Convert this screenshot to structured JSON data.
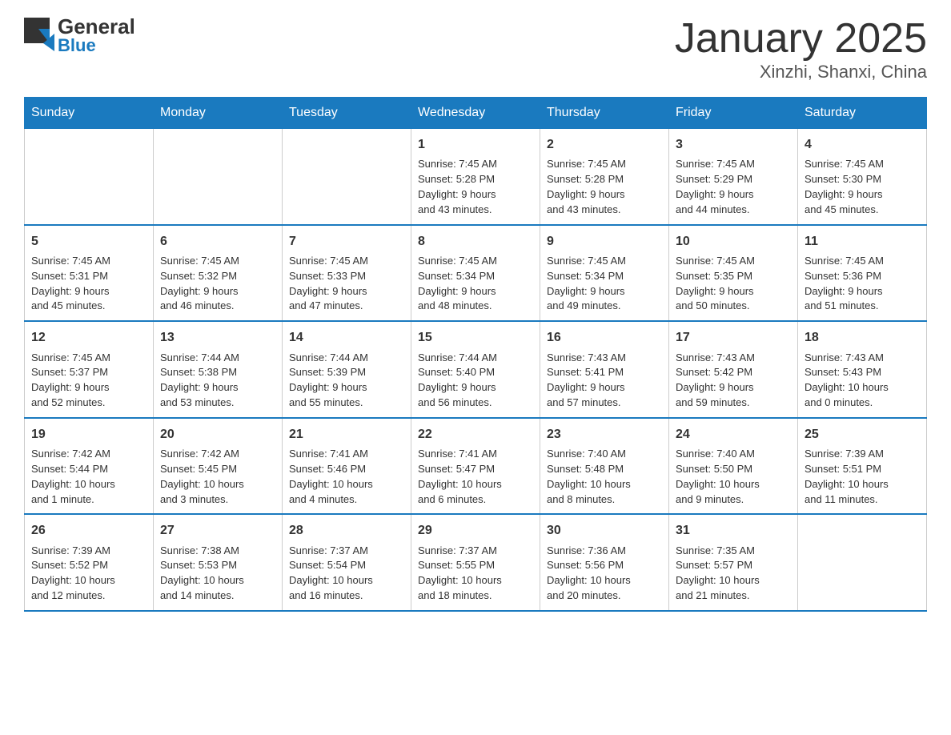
{
  "header": {
    "title": "January 2025",
    "subtitle": "Xinzhi, Shanxi, China",
    "logo": {
      "general": "General",
      "blue": "Blue"
    }
  },
  "weekdays": [
    "Sunday",
    "Monday",
    "Tuesday",
    "Wednesday",
    "Thursday",
    "Friday",
    "Saturday"
  ],
  "weeks": [
    [
      {
        "day": "",
        "info": ""
      },
      {
        "day": "",
        "info": ""
      },
      {
        "day": "",
        "info": ""
      },
      {
        "day": "1",
        "info": "Sunrise: 7:45 AM\nSunset: 5:28 PM\nDaylight: 9 hours\nand 43 minutes."
      },
      {
        "day": "2",
        "info": "Sunrise: 7:45 AM\nSunset: 5:28 PM\nDaylight: 9 hours\nand 43 minutes."
      },
      {
        "day": "3",
        "info": "Sunrise: 7:45 AM\nSunset: 5:29 PM\nDaylight: 9 hours\nand 44 minutes."
      },
      {
        "day": "4",
        "info": "Sunrise: 7:45 AM\nSunset: 5:30 PM\nDaylight: 9 hours\nand 45 minutes."
      }
    ],
    [
      {
        "day": "5",
        "info": "Sunrise: 7:45 AM\nSunset: 5:31 PM\nDaylight: 9 hours\nand 45 minutes."
      },
      {
        "day": "6",
        "info": "Sunrise: 7:45 AM\nSunset: 5:32 PM\nDaylight: 9 hours\nand 46 minutes."
      },
      {
        "day": "7",
        "info": "Sunrise: 7:45 AM\nSunset: 5:33 PM\nDaylight: 9 hours\nand 47 minutes."
      },
      {
        "day": "8",
        "info": "Sunrise: 7:45 AM\nSunset: 5:34 PM\nDaylight: 9 hours\nand 48 minutes."
      },
      {
        "day": "9",
        "info": "Sunrise: 7:45 AM\nSunset: 5:34 PM\nDaylight: 9 hours\nand 49 minutes."
      },
      {
        "day": "10",
        "info": "Sunrise: 7:45 AM\nSunset: 5:35 PM\nDaylight: 9 hours\nand 50 minutes."
      },
      {
        "day": "11",
        "info": "Sunrise: 7:45 AM\nSunset: 5:36 PM\nDaylight: 9 hours\nand 51 minutes."
      }
    ],
    [
      {
        "day": "12",
        "info": "Sunrise: 7:45 AM\nSunset: 5:37 PM\nDaylight: 9 hours\nand 52 minutes."
      },
      {
        "day": "13",
        "info": "Sunrise: 7:44 AM\nSunset: 5:38 PM\nDaylight: 9 hours\nand 53 minutes."
      },
      {
        "day": "14",
        "info": "Sunrise: 7:44 AM\nSunset: 5:39 PM\nDaylight: 9 hours\nand 55 minutes."
      },
      {
        "day": "15",
        "info": "Sunrise: 7:44 AM\nSunset: 5:40 PM\nDaylight: 9 hours\nand 56 minutes."
      },
      {
        "day": "16",
        "info": "Sunrise: 7:43 AM\nSunset: 5:41 PM\nDaylight: 9 hours\nand 57 minutes."
      },
      {
        "day": "17",
        "info": "Sunrise: 7:43 AM\nSunset: 5:42 PM\nDaylight: 9 hours\nand 59 minutes."
      },
      {
        "day": "18",
        "info": "Sunrise: 7:43 AM\nSunset: 5:43 PM\nDaylight: 10 hours\nand 0 minutes."
      }
    ],
    [
      {
        "day": "19",
        "info": "Sunrise: 7:42 AM\nSunset: 5:44 PM\nDaylight: 10 hours\nand 1 minute."
      },
      {
        "day": "20",
        "info": "Sunrise: 7:42 AM\nSunset: 5:45 PM\nDaylight: 10 hours\nand 3 minutes."
      },
      {
        "day": "21",
        "info": "Sunrise: 7:41 AM\nSunset: 5:46 PM\nDaylight: 10 hours\nand 4 minutes."
      },
      {
        "day": "22",
        "info": "Sunrise: 7:41 AM\nSunset: 5:47 PM\nDaylight: 10 hours\nand 6 minutes."
      },
      {
        "day": "23",
        "info": "Sunrise: 7:40 AM\nSunset: 5:48 PM\nDaylight: 10 hours\nand 8 minutes."
      },
      {
        "day": "24",
        "info": "Sunrise: 7:40 AM\nSunset: 5:50 PM\nDaylight: 10 hours\nand 9 minutes."
      },
      {
        "day": "25",
        "info": "Sunrise: 7:39 AM\nSunset: 5:51 PM\nDaylight: 10 hours\nand 11 minutes."
      }
    ],
    [
      {
        "day": "26",
        "info": "Sunrise: 7:39 AM\nSunset: 5:52 PM\nDaylight: 10 hours\nand 12 minutes."
      },
      {
        "day": "27",
        "info": "Sunrise: 7:38 AM\nSunset: 5:53 PM\nDaylight: 10 hours\nand 14 minutes."
      },
      {
        "day": "28",
        "info": "Sunrise: 7:37 AM\nSunset: 5:54 PM\nDaylight: 10 hours\nand 16 minutes."
      },
      {
        "day": "29",
        "info": "Sunrise: 7:37 AM\nSunset: 5:55 PM\nDaylight: 10 hours\nand 18 minutes."
      },
      {
        "day": "30",
        "info": "Sunrise: 7:36 AM\nSunset: 5:56 PM\nDaylight: 10 hours\nand 20 minutes."
      },
      {
        "day": "31",
        "info": "Sunrise: 7:35 AM\nSunset: 5:57 PM\nDaylight: 10 hours\nand 21 minutes."
      },
      {
        "day": "",
        "info": ""
      }
    ]
  ]
}
